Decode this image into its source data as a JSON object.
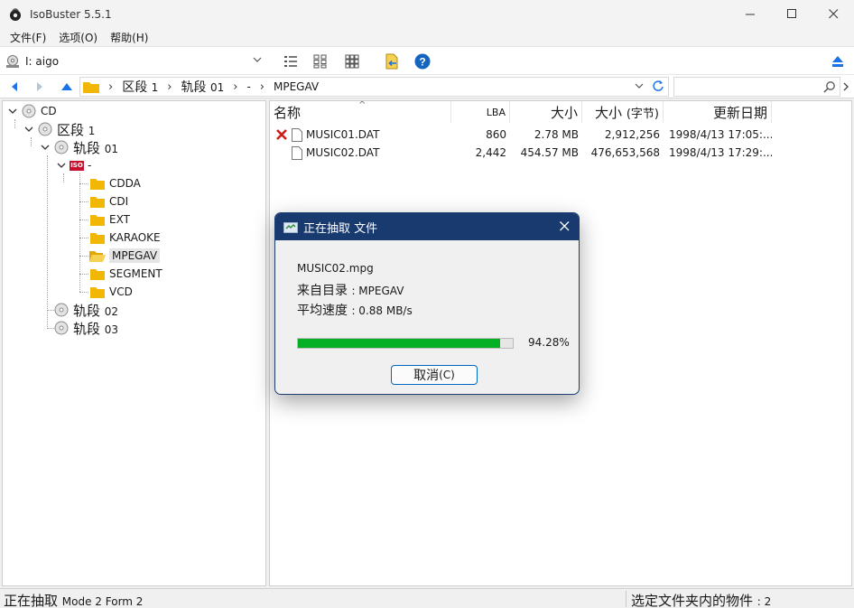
{
  "window": {
    "title": "IsoBuster 5.5.1"
  },
  "menu": {
    "items": [
      "文件(F)",
      "选项(O)",
      "帮助(H)"
    ]
  },
  "toolbar": {
    "drive": "I: aigo"
  },
  "breadcrumb": {
    "items": [
      {
        "label": "区段",
        "num": "1"
      },
      {
        "label": "轨段",
        "num": "01"
      },
      {
        "label": "-",
        "num": ""
      },
      {
        "label": "MPEGAV",
        "num": ""
      }
    ]
  },
  "tree": {
    "cd": "CD",
    "session": {
      "label": "区段",
      "num": "1"
    },
    "track01": {
      "label": "轨段",
      "num": "01"
    },
    "iso_label": "-",
    "iso_badge": "ISO",
    "folders": [
      "CDDA",
      "CDI",
      "EXT",
      "KARAOKE",
      "MPEGAV",
      "SEGMENT",
      "VCD"
    ],
    "track02": {
      "label": "轨段",
      "num": "02"
    },
    "track03": {
      "label": "轨段",
      "num": "03"
    }
  },
  "list": {
    "headers": {
      "name": "名称",
      "lba": "LBA",
      "size": "大小",
      "size_bytes": "大小",
      "size_bytes_unit": "(字节)",
      "date": "更新日期"
    },
    "rows": [
      {
        "name": "MUSIC01.DAT",
        "lba": "860",
        "size": "2.78 MB",
        "bytes": "2,912,256",
        "date": "1998/4/13 17:05:...",
        "error": true
      },
      {
        "name": "MUSIC02.DAT",
        "lba": "2,442",
        "size": "454.57 MB",
        "bytes": "476,653,568",
        "date": "1998/4/13 17:29:...",
        "error": false
      }
    ]
  },
  "dialog": {
    "title": "正在抽取 文件",
    "filename": "MUSIC02.mpg",
    "from_label": "来自目录",
    "from_value": ": MPEGAV",
    "speed_label": "平均速度",
    "speed_value": ": 0.88 MB/s",
    "progress": 0.9428,
    "percent_text": "94.28%",
    "cancel_label": "取消",
    "cancel_key": "(C)"
  },
  "status": {
    "left_main": "正在抽取",
    "left_detail": "Mode 2 Form 2",
    "right_main": "选定文件夹内的物件",
    "right_detail": ": 2"
  },
  "colors": {
    "progress_fill": "#06b025",
    "dialog_title_bg": "#193a6f",
    "folder": "#f2b705",
    "error_x": "#d11a1a",
    "accent_blue": "#1a73e8"
  }
}
